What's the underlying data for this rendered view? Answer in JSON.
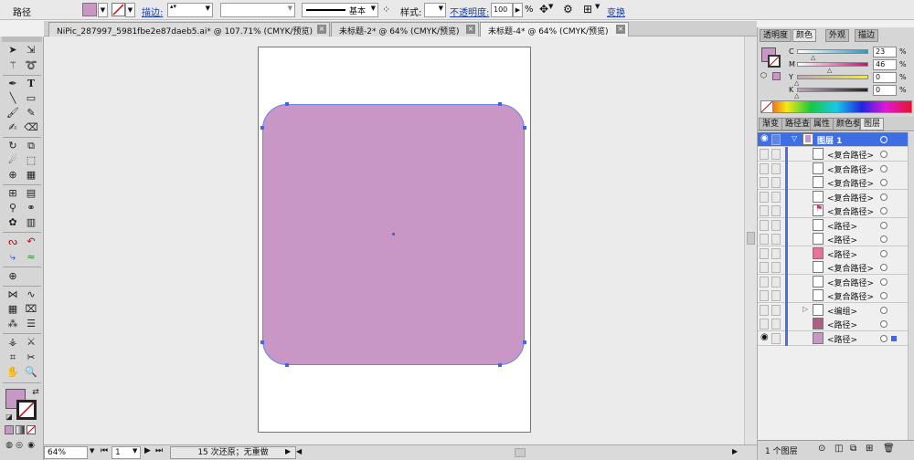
{
  "control_bar": {
    "object_type": "路径",
    "fill_color": "#c897c6",
    "stroke_label": "描边:",
    "stroke_style_label": "基本",
    "style_label": "样式:",
    "opacity_label": "不透明度:",
    "opacity_value": "100",
    "percent": "%",
    "transform_label": "变换"
  },
  "tabs": [
    {
      "label": "NiPic_287997_5981fbe2e87daeb5.ai* @ 107.71% (CMYK/预览)",
      "active": false
    },
    {
      "label": "未标题-2* @ 64% (CMYK/预览)",
      "active": false
    },
    {
      "label": "未标题-4* @ 64% (CMYK/预览)",
      "active": true
    }
  ],
  "tab_close": "×",
  "canvas": {
    "artboard_fill": "#ffffff",
    "shape_fill": "#c897c6",
    "selection_color": "#3f66ec"
  },
  "status_bar": {
    "zoom": "64%",
    "artboard_number": "1",
    "undo_info": "15 次还原；无重做"
  },
  "color_panel": {
    "tabs": [
      "透明度",
      "颜色",
      "外观",
      "描边"
    ],
    "active_tab": "颜色",
    "channels": [
      {
        "name": "C",
        "value": "23",
        "gradient": "linear-gradient(90deg,#ffffff,#00a8e8)",
        "level": 0.23
      },
      {
        "name": "M",
        "value": "46",
        "gradient": "linear-gradient(90deg,#ffffff,#e4007c)",
        "level": 0.46
      },
      {
        "name": "Y",
        "value": "0",
        "gradient": "linear-gradient(90deg,#c7a1c6,#ffef00)",
        "level": 0.0
      },
      {
        "name": "K",
        "value": "0",
        "gradient": "linear-gradient(90deg,#c7a1c6,#222222)",
        "level": 0.0
      }
    ],
    "percent_sign": "%"
  },
  "layers_panel": {
    "tabs": [
      "渐变",
      "路径查",
      "属性",
      "颜色参",
      "图层"
    ],
    "active_tab": "图层",
    "layer_name": "图层 1",
    "items": [
      {
        "label": "<复合路径>",
        "thumb": "#ffffff",
        "visible": false,
        "expander": false
      },
      {
        "label": "<复合路径>",
        "thumb": "#ffffff",
        "visible": false,
        "expander": false
      },
      {
        "label": "<复合路径>",
        "thumb": "#ffffff",
        "visible": false,
        "expander": false
      },
      {
        "label": "<复合路径>",
        "thumb": "#ffffff",
        "visible": false,
        "expander": false
      },
      {
        "label": "<复合路径>",
        "thumb": "#ffffff",
        "visible": false,
        "expander": false,
        "thumb_mark": "#d0337a"
      },
      {
        "label": "<路径>",
        "thumb": "#ffffff",
        "visible": false,
        "expander": false
      },
      {
        "label": "<路径>",
        "thumb": "#ffffff",
        "visible": false,
        "expander": false
      },
      {
        "label": "<路径>",
        "thumb": "#e8709a",
        "visible": false,
        "expander": false
      },
      {
        "label": "<复合路径>",
        "thumb": "#ffffff",
        "visible": false,
        "expander": false
      },
      {
        "label": "<复合路径>",
        "thumb": "#ffffff",
        "visible": false,
        "expander": false
      },
      {
        "label": "<复合路径>",
        "thumb": "#ffffff",
        "visible": false,
        "expander": false
      },
      {
        "label": "<编组>",
        "thumb": "#ffffff",
        "visible": false,
        "expander": true
      },
      {
        "label": "<路径>",
        "thumb": "#b15c83",
        "visible": false,
        "expander": false
      },
      {
        "label": "<路径>",
        "thumb": "#c897c6",
        "visible": true,
        "expander": false
      }
    ],
    "footer": "1 个图层"
  }
}
